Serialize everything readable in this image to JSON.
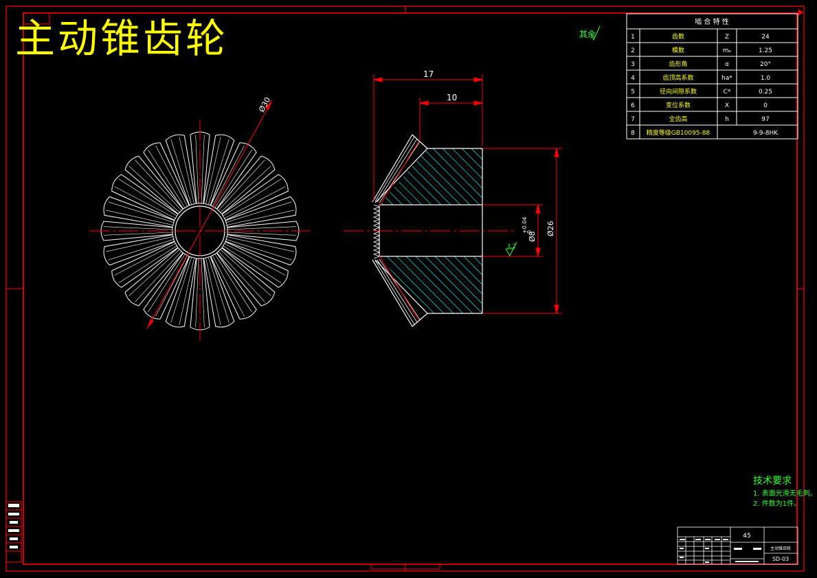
{
  "title": "主动锥齿轮",
  "roughness_other": "其余",
  "roughness_value": "3.2",
  "params_table": {
    "header": "啮 合 特 性",
    "rows": [
      {
        "no": "1",
        "name": "齿数",
        "sym": "Z",
        "val": "24"
      },
      {
        "no": "2",
        "name": "模数",
        "sym": "mₑ",
        "val": "1.25"
      },
      {
        "no": "3",
        "name": "齿形角",
        "sym": "α",
        "val": "20°"
      },
      {
        "no": "4",
        "name": "齿顶高系数",
        "sym": "ha*",
        "val": "1.0"
      },
      {
        "no": "5",
        "name": "径向间隙系数",
        "sym": "C*",
        "val": "0.25"
      },
      {
        "no": "6",
        "name": "变位系数",
        "sym": "X",
        "val": "0"
      },
      {
        "no": "7",
        "name": "全齿高",
        "sym": "h",
        "val": "97"
      },
      {
        "no": "8",
        "name": "精度等级GB10095-88",
        "sym": "",
        "val": "9-9-8HK"
      }
    ]
  },
  "dims": {
    "dia_front": "Ø30",
    "len_total": "17",
    "len_hub": "10",
    "dia_outer": "Ø26",
    "bore": "Ø8",
    "bore_tol_upper": "+0.04",
    "bore_tol_lower": "0"
  },
  "tech_req": {
    "title": "技术要求",
    "items": [
      "1. 表面光滑无毛刺。",
      "2. 件数为1件。"
    ]
  },
  "title_block": {
    "material": "45",
    "name": "主动锥齿轮",
    "drawing_no": "SD-03"
  },
  "colors": {
    "frame": "#ff0000",
    "outline": "#ffffff",
    "hatch": "#00cccc",
    "title_text": "#ffff00",
    "note_text": "#33ff33"
  }
}
